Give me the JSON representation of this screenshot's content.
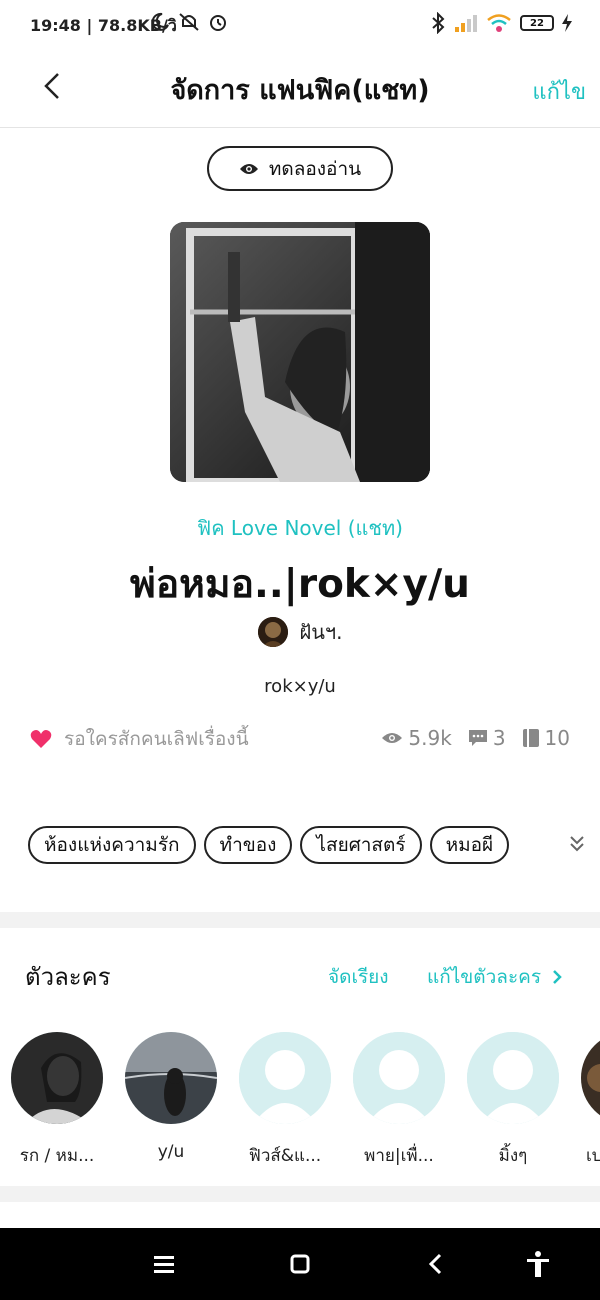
{
  "status_bar": {
    "time_speed": "19:48 | 78.8KB/วิ",
    "battery": "22"
  },
  "header": {
    "title": "จัดการ แฟนฟิค(แชท)",
    "edit_label": "แก้ไข"
  },
  "preview_button": {
    "label": "ทดลองอ่าน"
  },
  "story": {
    "category": "ฟิค Love Novel (แชท)",
    "title": "พ่อหมอ..|rok×y/u",
    "author": "ฝันฯ.",
    "subtitle": "rok×y/u"
  },
  "stats": {
    "like_text": "รอใครสักคนเลิฟเรื่องนี้",
    "views": "5.9k",
    "comments": "3",
    "chapters": "10"
  },
  "tags": [
    "ห้องแห่งความรัก",
    "ทำของ",
    "ไสยศาสตร์",
    "หมอผี"
  ],
  "characters_section": {
    "heading": "ตัวละคร",
    "sort_label": "จัดเรียง",
    "edit_label": "แก้ไขตัวละคร",
    "items": [
      {
        "name": "รก / หม...",
        "avatar": "photo-man"
      },
      {
        "name": "y/u",
        "avatar": "photo-sea"
      },
      {
        "name": "ฟิวส์&แ...",
        "avatar": "placeholder"
      },
      {
        "name": "พาย|เพื่...",
        "avatar": "placeholder"
      },
      {
        "name": "มิ้งๆ",
        "avatar": "placeholder"
      },
      {
        "name": "เบ",
        "avatar": "photo-partial"
      }
    ]
  },
  "colors": {
    "accent": "#1fc1c1",
    "like": "#f0306a",
    "placeholder_avatar": "#d6eff0"
  }
}
